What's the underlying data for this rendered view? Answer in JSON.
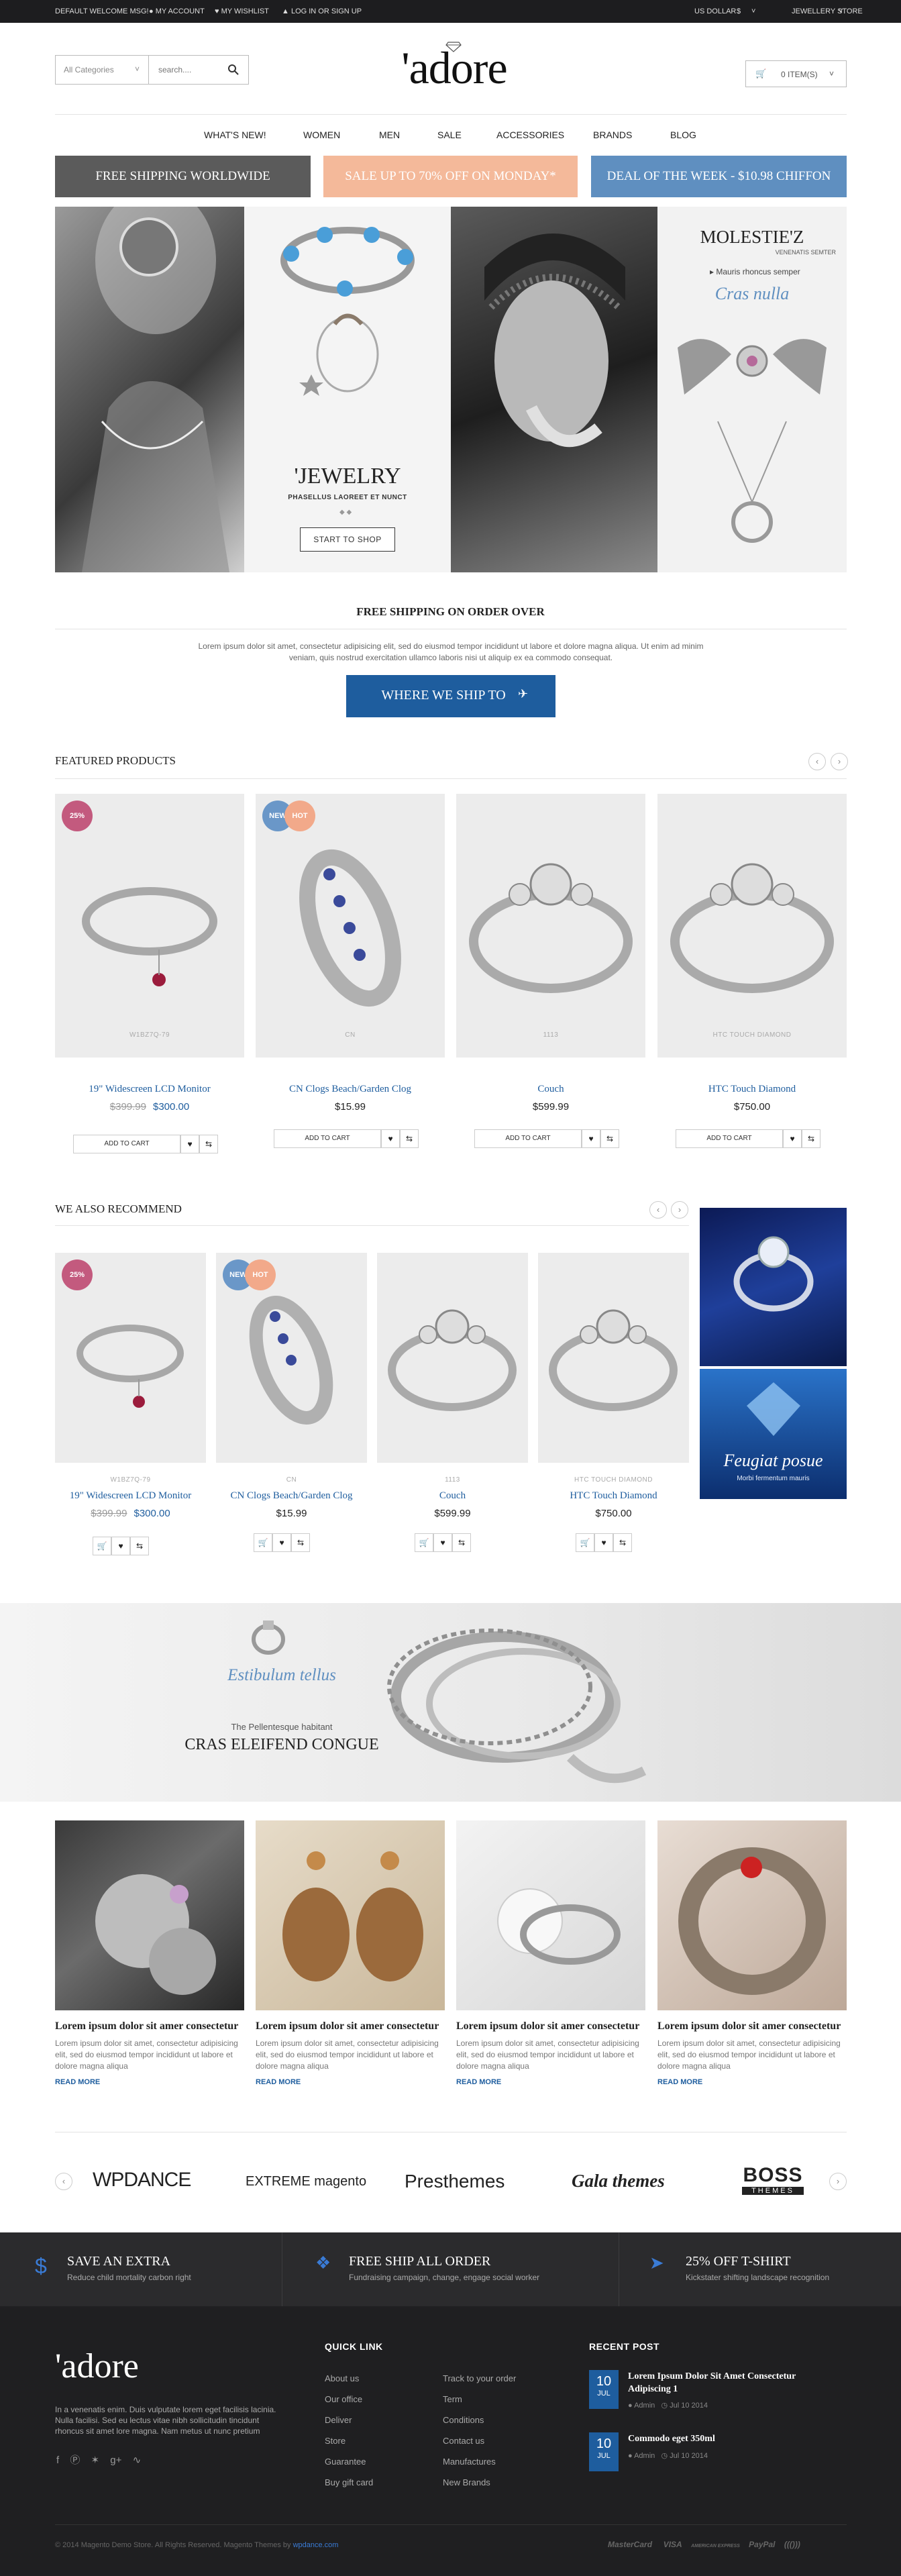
{
  "topbar": {
    "welcome": "DEFAULT WELCOME MSG!",
    "account": "MY ACCOUNT",
    "wishlist": "MY WISHLIST",
    "login": "LOG IN OR SIGN UP",
    "currency": "US DOLLAR",
    "currency_symbol": "$",
    "store": "JEWELLERY STORE"
  },
  "header": {
    "category": "All Categories",
    "search_placeholder": "search....",
    "logo": "'adore",
    "cart": "0 ITEM(S)"
  },
  "nav": [
    "WHAT'S NEW!",
    "WOMEN",
    "MEN",
    "SALE",
    "ACCESSORIES",
    "BRANDS",
    "BLOG"
  ],
  "promos": [
    "FREE SHIPPING WORLDWIDE",
    "SALE UP TO 70% OFF ON MONDAY*",
    "DEAL OF THE WEEK - $10.98 CHIFFON"
  ],
  "hero": {
    "jewelry_title": "'JEWELRY",
    "jewelry_sub": "PHASELLUS LAOREET ET NUNCT",
    "start_btn": "START TO SHOP",
    "molestie_title": "MOLESTIE'Z",
    "molestie_sub": "VENENATIS SEMTER",
    "molestie_line": "Mauris rhoncus semper",
    "molestie_script": "Cras nulla"
  },
  "shipping": {
    "title": "FREE SHIPPING ON ORDER OVER",
    "text1": "Lorem ipsum dolor sit amet, consectetur adipisicing elit, sed do eiusmod tempor incididunt ut labore et dolore magna aliqua. Ut enim ad minim",
    "text2": "veniam, quis nostrud exercitation ullamco laboris nisi ut aliquip ex ea commodo consequat.",
    "button": "WHERE WE SHIP TO"
  },
  "featured": {
    "title": "FEATURED PRODUCTS",
    "add_to_cart": "ADD TO CART",
    "products": [
      {
        "brand": "W1BZ7Q-79",
        "name": "19\" Widescreen LCD Monitor",
        "old_price": "$399.99",
        "price": "$300.00",
        "badge": "25%"
      },
      {
        "brand": "CN",
        "name": "CN Clogs Beach/Garden Clog",
        "price": "$15.99",
        "badge_new": "NEW",
        "badge_hot": "HOT"
      },
      {
        "brand": "1113",
        "name": "Couch",
        "price": "$599.99"
      },
      {
        "brand": "HTC TOUCH DIAMOND",
        "name": "HTC Touch Diamond",
        "price": "$750.00"
      }
    ]
  },
  "recommend": {
    "title": "WE ALSO RECOMMEND",
    "products": [
      {
        "brand": "W1BZ7Q-79",
        "name": "19\" Widescreen LCD Monitor",
        "old_price": "$399.99",
        "price": "$300.00",
        "badge": "25%"
      },
      {
        "brand": "CN",
        "name": "CN Clogs Beach/Garden Clog",
        "price": "$15.99",
        "badge_new": "NEW",
        "badge_hot": "HOT"
      },
      {
        "brand": "1113",
        "name": "Couch",
        "price": "$599.99"
      },
      {
        "brand": "HTC TOUCH DIAMOND",
        "name": "HTC Touch Diamond",
        "price": "$750.00"
      }
    ],
    "side_script": "Feugiat posue",
    "side_sub": "Morbi fermentum mauris"
  },
  "banner": {
    "script": "Estibulum tellus",
    "sub": "The Pellentesque habitant",
    "title": "CRAS ELEIFEND CONGUE"
  },
  "blog": {
    "read_more": "READ MORE",
    "posts": [
      {
        "title": "Lorem ipsum dolor sit amer consectetur",
        "text": "Lorem ipsum dolor sit amet, consectetur adipisicing elit, sed do eiusmod tempor incididunt ut labore et dolore magna aliqua"
      },
      {
        "title": "Lorem ipsum dolor sit amer consectetur",
        "text": "Lorem ipsum dolor sit amet, consectetur adipisicing elit, sed do eiusmod tempor incididunt ut labore et dolore magna aliqua"
      },
      {
        "title": "Lorem ipsum dolor sit amer consectetur",
        "text": "Lorem ipsum dolor sit amet, consectetur adipisicing elit, sed do eiusmod tempor incididunt ut labore et dolore magna aliqua"
      },
      {
        "title": "Lorem ipsum dolor sit amer consectetur",
        "text": "Lorem ipsum dolor sit amet, consectetur adipisicing elit, sed do eiusmod tempor incididunt ut labore et dolore magna aliqua"
      }
    ]
  },
  "brands": [
    "WPDANCE",
    "EXTREME magento",
    "Presthemes",
    "Gala themes",
    "BOSS",
    "THEMES"
  ],
  "features": [
    {
      "title": "SAVE AN EXTRA",
      "text": "Reduce child mortality carbon right"
    },
    {
      "title": "FREE SHIP ALL ORDER",
      "text": "Fundraising campaign, change, engage social worker"
    },
    {
      "title": "25% OFF T-SHIRT",
      "text": "Kickstater shifting landscape recognition"
    }
  ],
  "footer": {
    "logo": "'adore",
    "about": [
      "In a venenatis enim. Duis vulputate lorem eget facilisis lacinia.",
      "Nulla facilisi. Sed eu lectus vitae nibh sollicitudin tincidunt",
      "rhoncus sit amet lore magna. Nam metus ut nunc pretium"
    ],
    "quick_title": "QUICK LINK",
    "links_col1": [
      "About us",
      "Our office",
      "Deliver",
      "Store",
      "Guarantee",
      "Buy gift card"
    ],
    "links_col2": [
      "Track to your order",
      "Term",
      "Conditions",
      "Contact us",
      "Manufactures",
      "New Brands"
    ],
    "recent_title": "RECENT POST",
    "posts": [
      {
        "day": "10",
        "month": "JUL",
        "title": "Lorem Ipsum Dolor Sit Amet Consectetur Adipiscing 1",
        "author": "Admin",
        "date": "Jul 10 2014"
      },
      {
        "day": "10",
        "month": "JUL",
        "title": "Commodo eget 350ml",
        "author": "Admin",
        "date": "Jul 10 2014"
      }
    ],
    "copyright": "© 2014 Magento Demo Store. All Rights Reserved. Magento Themes by ",
    "copyright_link": "wpdance.com",
    "payments": [
      "MasterCard",
      "VISA",
      "AMERICAN EXPRESS",
      "PayPal",
      "((()))"
    ]
  },
  "colors": {
    "accent": "#1e5d9e",
    "promo1": "#5b5b5b",
    "promo2": "#f4b99a",
    "promo3": "#5f8fc0",
    "badge_sale": "#c35a7e",
    "badge_new": "#6a97c8",
    "badge_hot": "#f2a98a"
  }
}
